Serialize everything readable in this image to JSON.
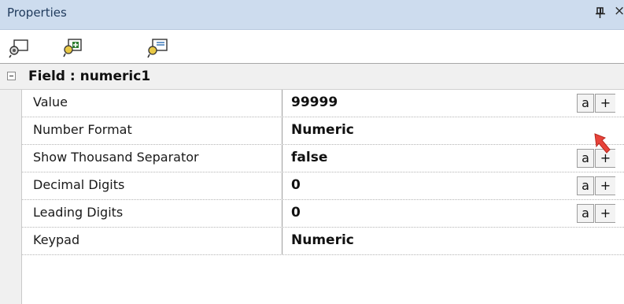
{
  "panel": {
    "title": "Properties",
    "pin_icon": "pin-icon",
    "close_label": "×"
  },
  "toolbar": {
    "buttons": [
      {
        "icon": "properties-view-icon"
      },
      {
        "icon": "add-property-icon"
      },
      {
        "icon": "remove-property-icon"
      }
    ]
  },
  "grid": {
    "category": {
      "label": "Field : numeric1",
      "expanded": true
    },
    "rows": [
      {
        "name": "Value",
        "value": "99999",
        "buttons": [
          "a",
          "+"
        ]
      },
      {
        "name": "Number Format",
        "value": "Numeric",
        "buttons": []
      },
      {
        "name": "Show Thousand Separator",
        "value": "false",
        "buttons": [
          "a",
          "+"
        ]
      },
      {
        "name": "Decimal Digits",
        "value": "0",
        "buttons": [
          "a",
          "+"
        ]
      },
      {
        "name": "Leading Digits",
        "value": "0",
        "buttons": [
          "a",
          "+"
        ]
      },
      {
        "name": "Keypad",
        "value": "Numeric",
        "buttons": []
      }
    ]
  },
  "colors": {
    "title_bar": "#cddcee",
    "gutter": "#f0f0f0",
    "cursor": "#e8433a"
  }
}
